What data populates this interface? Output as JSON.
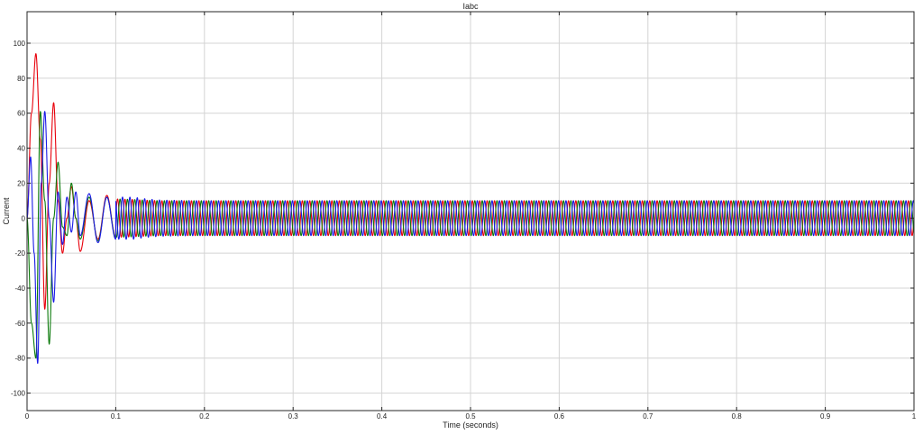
{
  "chart_data": {
    "type": "line",
    "title": "Iabc",
    "xlabel": "Time (seconds)",
    "ylabel": "Current",
    "xlim": [
      0,
      1
    ],
    "ylim": [
      -110,
      118
    ],
    "xticks": [
      0,
      0.1,
      0.2,
      0.3,
      0.4,
      0.5,
      0.6,
      0.7,
      0.8,
      0.9,
      1
    ],
    "xtick_labels": [
      "0",
      "0.1",
      "0.2",
      "0.3",
      "0.4",
      "0.5",
      "0.6",
      "0.7",
      "0.8",
      "0.9",
      "1"
    ],
    "yticks": [
      -100,
      -80,
      -60,
      -40,
      -20,
      0,
      20,
      40,
      60,
      80,
      100
    ],
    "ytick_labels": [
      "-100",
      "-80",
      "-60",
      "-40",
      "-20",
      "0",
      "20",
      "40",
      "60",
      "80",
      "100"
    ],
    "grid": true,
    "steady_state_frequency_hz": 120,
    "steady_state_amplitude": 10,
    "series": [
      {
        "color": "#e8000b",
        "x": [
          0,
          0.005,
          0.01,
          0.015,
          0.02,
          0.025,
          0.03,
          0.035,
          0.04,
          0.045,
          0.05,
          0.055,
          0.06,
          0.07,
          0.08,
          0.09,
          0.1,
          0.12,
          0.15,
          0.2,
          0.3,
          0.5,
          1.0
        ],
        "y": [
          0,
          60,
          94,
          45,
          -52,
          20,
          66,
          10,
          -20,
          0,
          18,
          0,
          -19,
          10,
          -12,
          13,
          -11,
          11,
          -10,
          10,
          -10,
          10,
          -10
        ],
        "steady_phase_deg": 0
      },
      {
        "color": "#0b7a0b",
        "x": [
          0,
          0.005,
          0.01,
          0.015,
          0.02,
          0.025,
          0.03,
          0.035,
          0.04,
          0.045,
          0.05,
          0.055,
          0.06,
          0.07,
          0.08,
          0.09,
          0.1,
          0.12,
          0.15,
          0.2,
          0.3,
          0.5,
          1.0
        ],
        "y": [
          0,
          -60,
          -80,
          61,
          10,
          -72,
          0,
          32,
          -5,
          -10,
          20,
          0,
          -12,
          12,
          -13,
          12,
          -11,
          11,
          -10,
          10,
          -10,
          10,
          -10
        ],
        "steady_phase_deg": -120
      },
      {
        "color": "#1a1ae6",
        "x": [
          0,
          0.004,
          0.008,
          0.012,
          0.016,
          0.02,
          0.025,
          0.03,
          0.035,
          0.04,
          0.045,
          0.05,
          0.055,
          0.06,
          0.07,
          0.08,
          0.09,
          0.1,
          0.12,
          0.15,
          0.2,
          0.3,
          0.5,
          1.0
        ],
        "y": [
          0,
          35,
          -20,
          -83,
          20,
          61,
          0,
          -48,
          15,
          -15,
          12,
          -8,
          15,
          -10,
          14,
          -14,
          12,
          -12,
          13,
          -11,
          10,
          -10,
          10,
          -10
        ],
        "steady_phase_deg": 120
      }
    ]
  }
}
